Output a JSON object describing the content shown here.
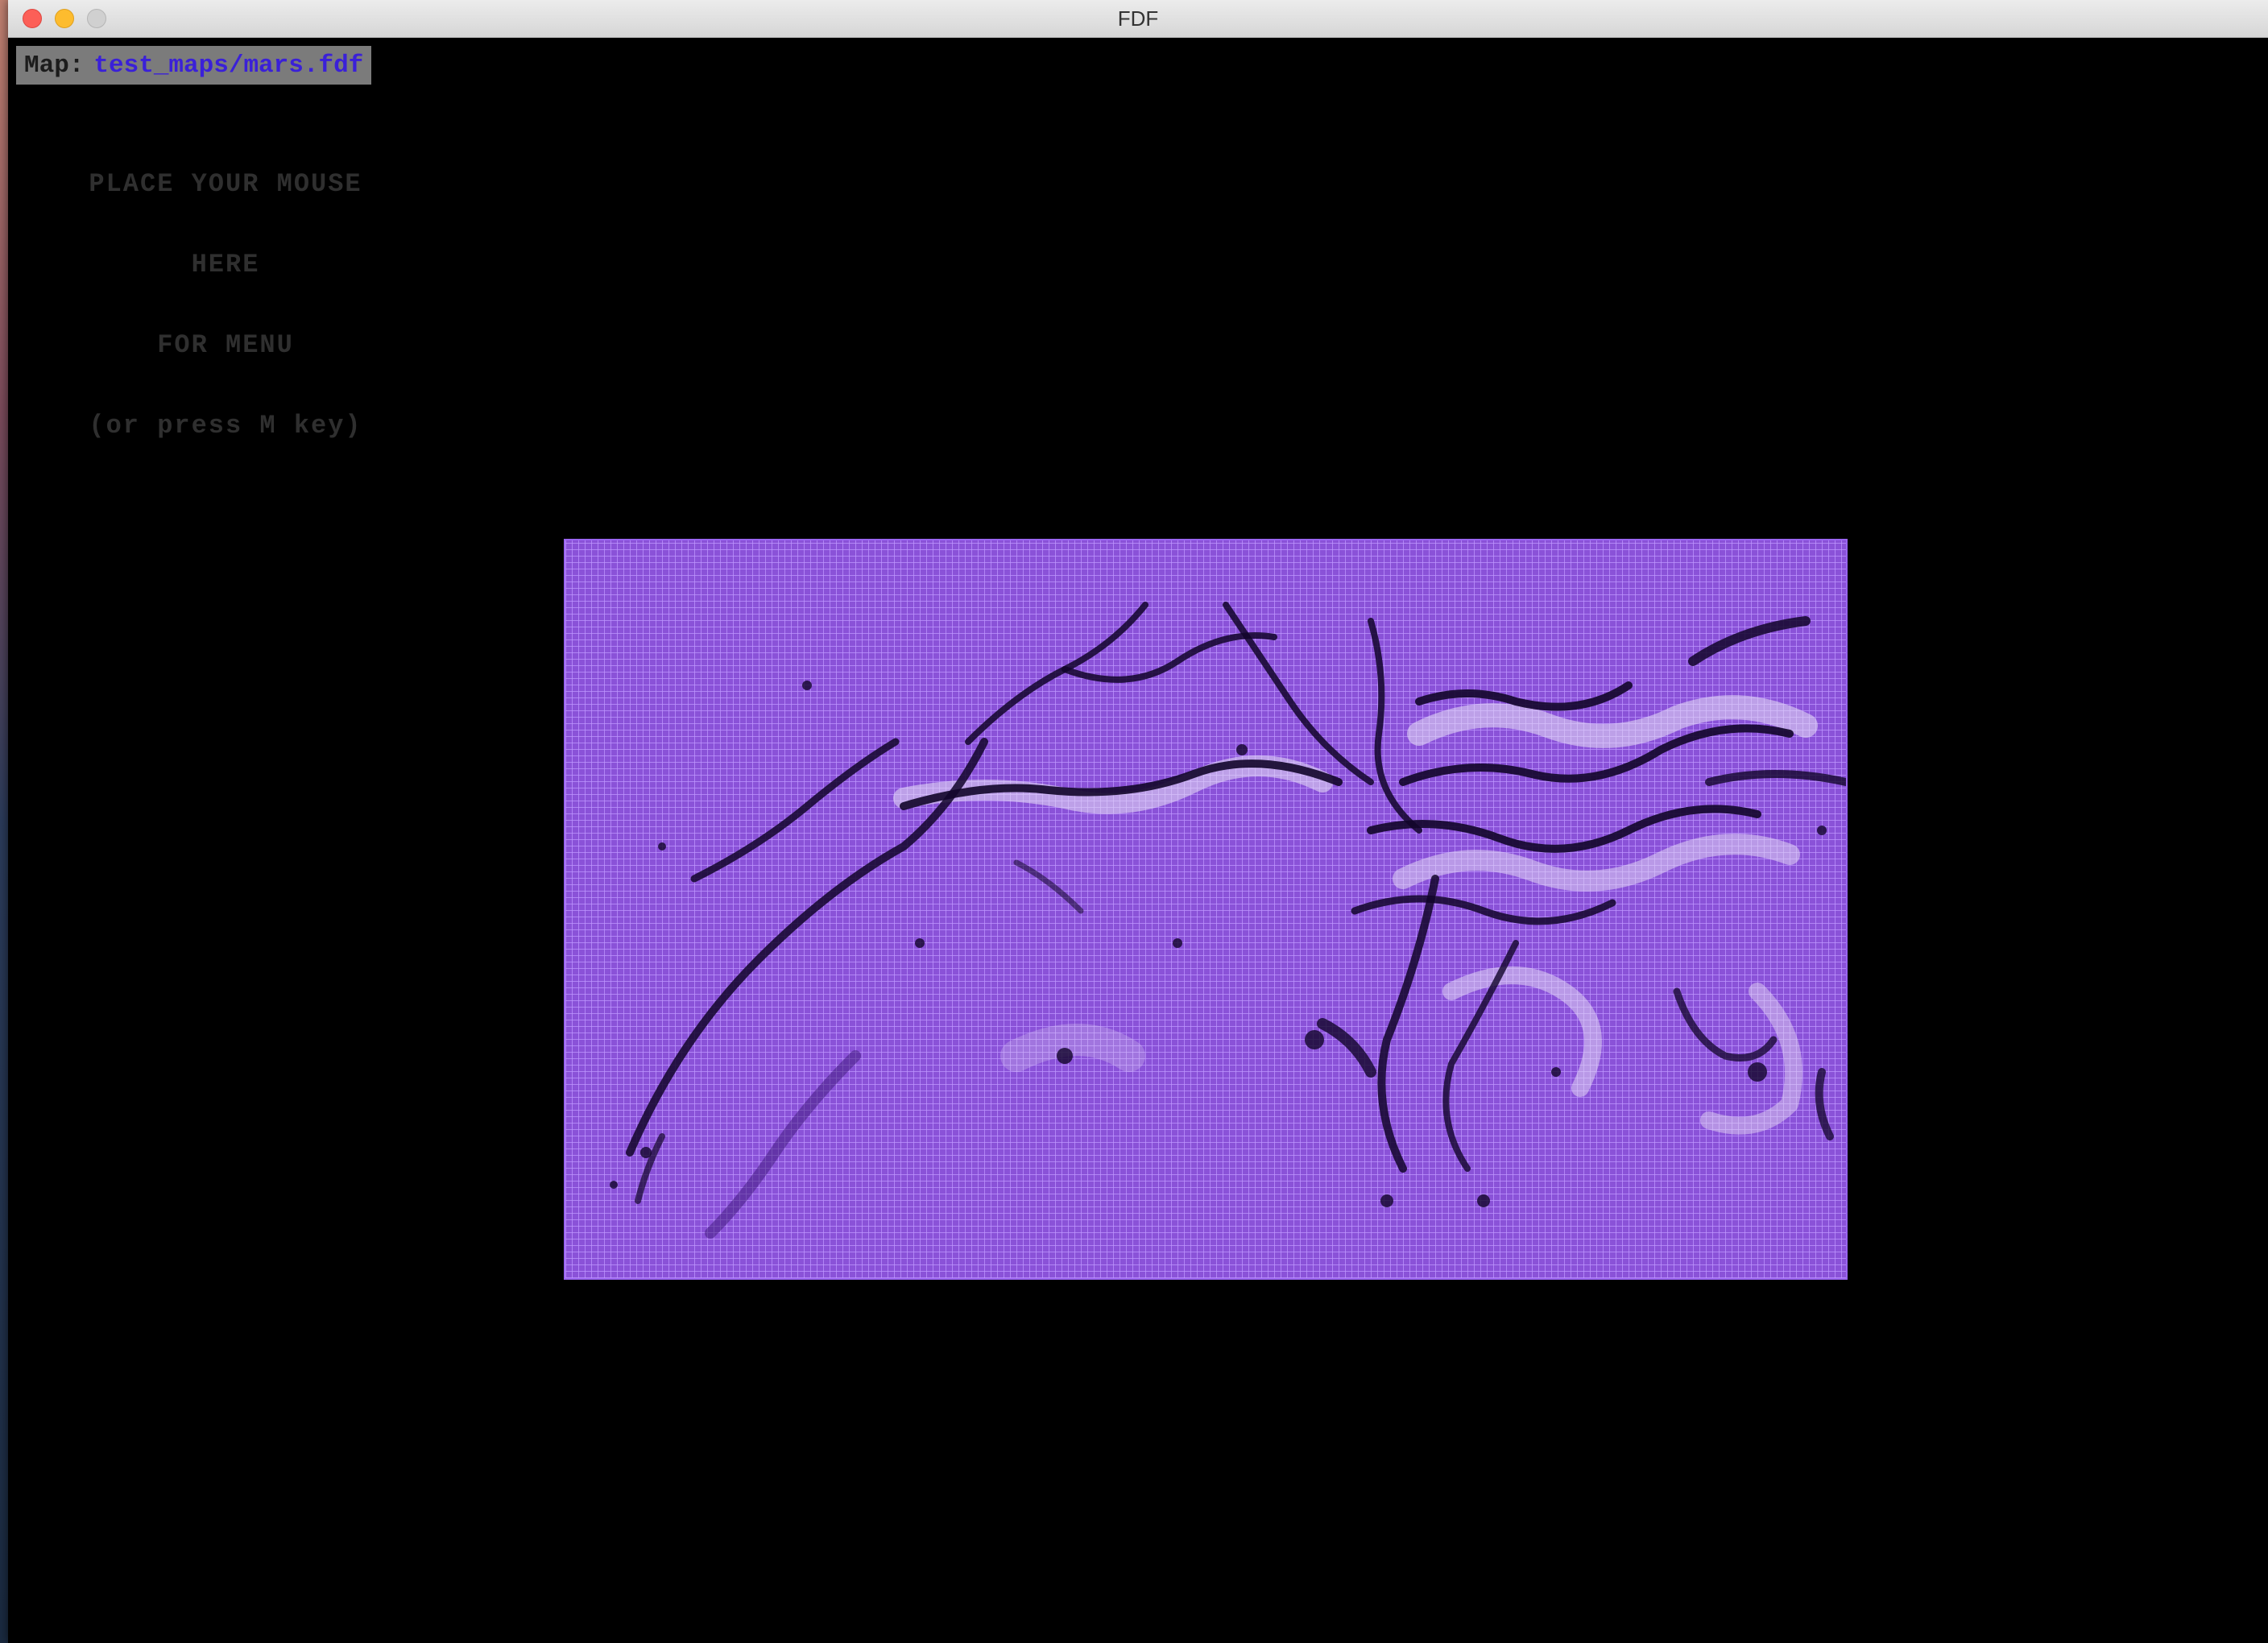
{
  "window": {
    "title": "FDF"
  },
  "map_label": {
    "key": "Map:",
    "file": "test_maps/mars.fdf"
  },
  "menu_hint": {
    "line1": "PLACE YOUR MOUSE",
    "line2": "HERE",
    "line3": "FOR MENU",
    "line4": "(or press M key)"
  },
  "render": {
    "grid_color": "#b08cff",
    "base_color": "#8a52d8",
    "ridge_dark_color": "#12052a",
    "highlight_color": "#e8e0f5"
  }
}
